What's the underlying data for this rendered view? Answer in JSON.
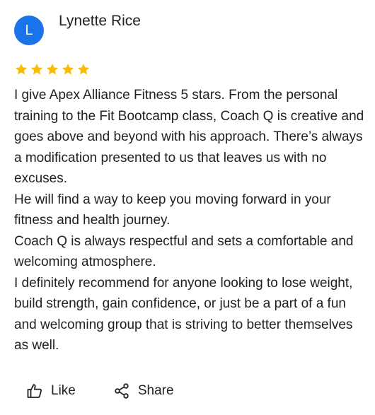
{
  "reviewer": {
    "initial": "L",
    "name": "Lynette Rice",
    "avatar_color": "#1a73e8"
  },
  "rating": {
    "stars": 5,
    "max": 5,
    "star_color": "#fbbc04"
  },
  "review": {
    "paragraphs": [
      "I give Apex Alliance Fitness 5 stars. From the personal training to the Fit Bootcamp class, Coach Q is creative and goes above and beyond with his approach. There’s always a modification presented to us that leaves us with no excuses.",
      "He will find a way to keep you moving forward in your fitness and health journey.",
      "Coach Q is always respectful and sets a comfortable and welcoming atmosphere.",
      "I definitely recommend for anyone looking to lose weight, build strength, gain confidence, or just be a part of a fun and welcoming group that is striving to better themselves as well."
    ]
  },
  "actions": {
    "like_label": "Like",
    "like_icon": "thumbs-up-icon",
    "share_label": "Share",
    "share_icon": "share-icon"
  }
}
